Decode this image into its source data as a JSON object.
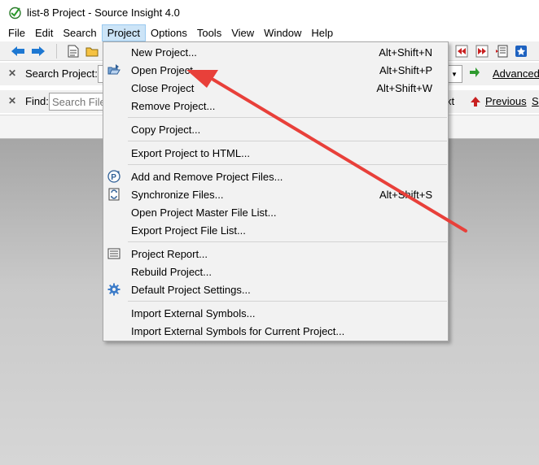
{
  "window": {
    "title": "list-8 Project - Source Insight 4.0"
  },
  "menubar": [
    "File",
    "Edit",
    "Search",
    "Project",
    "Options",
    "Tools",
    "View",
    "Window",
    "Help"
  ],
  "searchbar": {
    "label": "Search Project:",
    "advanced": "Advanced"
  },
  "findbar": {
    "label": "Find:",
    "placeholder": "Search File",
    "next_fragment": "xt",
    "previous": "Previous",
    "s_fragment": "S"
  },
  "project_menu": {
    "items": [
      {
        "label": "New Project...",
        "shortcut": "Alt+Shift+N",
        "icon": ""
      },
      {
        "label": "Open Project...",
        "shortcut": "Alt+Shift+P",
        "icon": "open-project-icon"
      },
      {
        "label": "Close Project",
        "shortcut": "Alt+Shift+W",
        "icon": ""
      },
      {
        "label": "Remove Project...",
        "shortcut": "",
        "icon": ""
      },
      {
        "label": "Copy Project...",
        "shortcut": "",
        "icon": ""
      },
      {
        "label": "Export Project to HTML...",
        "shortcut": "",
        "icon": ""
      },
      {
        "label": "Add and Remove Project Files...",
        "shortcut": "",
        "icon": "add-remove-files-icon"
      },
      {
        "label": "Synchronize Files...",
        "shortcut": "Alt+Shift+S",
        "icon": "synchronize-icon"
      },
      {
        "label": "Open Project Master File List...",
        "shortcut": "",
        "icon": ""
      },
      {
        "label": "Export Project File List...",
        "shortcut": "",
        "icon": ""
      },
      {
        "label": "Project Report...",
        "shortcut": "",
        "icon": "report-icon"
      },
      {
        "label": "Rebuild Project...",
        "shortcut": "",
        "icon": ""
      },
      {
        "label": "Default Project Settings...",
        "shortcut": "",
        "icon": "gear-icon"
      },
      {
        "label": "Import External Symbols...",
        "shortcut": "",
        "icon": ""
      },
      {
        "label": "Import External Symbols for Current Project...",
        "shortcut": "",
        "icon": ""
      }
    ]
  },
  "annotation": {
    "arrow_color": "#e8403a"
  }
}
